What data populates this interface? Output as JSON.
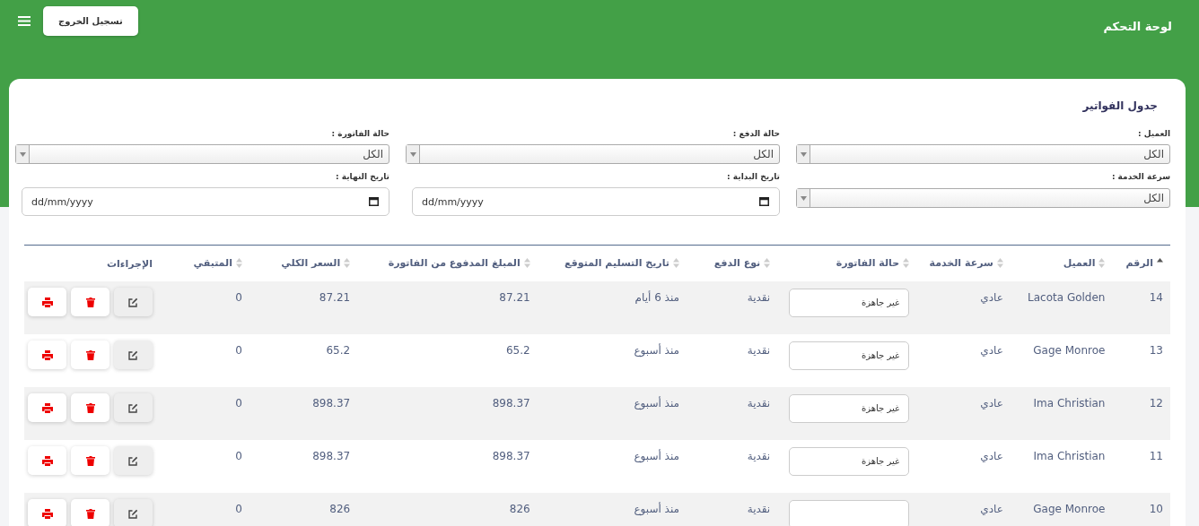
{
  "header": {
    "title": "لوحة التحكم",
    "logout": "تسجيل الخروج"
  },
  "card": {
    "title": "جدول الفواتير"
  },
  "filters": [
    {
      "kind": "select",
      "label": "العميل :",
      "value": "الكل"
    },
    {
      "kind": "select",
      "label": "حالة الدفع :",
      "value": "الكل"
    },
    {
      "kind": "select",
      "label": "حالة الفاتورة :",
      "value": "الكل"
    },
    {
      "kind": "select",
      "label": "سرعة الخدمة :",
      "value": "الكل"
    },
    {
      "kind": "date",
      "label": "تاريخ البداية :",
      "placeholder": "dd/mm/yyyy"
    },
    {
      "kind": "date",
      "label": "تاريخ النهاية :",
      "placeholder": "dd/mm/yyyy"
    }
  ],
  "table": {
    "columns": [
      {
        "label": "الرقم",
        "sortable": true,
        "sorted": true
      },
      {
        "label": "العميل",
        "sortable": true,
        "sorted": false
      },
      {
        "label": "سرعة الخدمة",
        "sortable": true,
        "sorted": false
      },
      {
        "label": "حالة الفاتورة",
        "sortable": true,
        "sorted": false
      },
      {
        "label": "نوع الدفع",
        "sortable": true,
        "sorted": false
      },
      {
        "label": "تاريخ التسليم المتوقع",
        "sortable": true,
        "sorted": false
      },
      {
        "label": "المبلغ المدفوع من الفاتورة",
        "sortable": true,
        "sorted": false
      },
      {
        "label": "السعر الكلي",
        "sortable": true,
        "sorted": false
      },
      {
        "label": "المتبقي",
        "sortable": true,
        "sorted": false
      },
      {
        "label": "الإجراءات",
        "sortable": false
      }
    ],
    "actions": [
      {
        "kind": "edit"
      },
      {
        "kind": "delete"
      },
      {
        "kind": "print"
      }
    ],
    "rows": [
      {
        "id": "14",
        "client": "Lacota Golden",
        "speed": "عادي",
        "status": "غير جاهزة",
        "payment": "نقدية",
        "delivery": "منذ 6 أيام",
        "paid": "87.21",
        "total": "87.21",
        "remaining": "0"
      },
      {
        "id": "13",
        "client": "Gage Monroe",
        "speed": "عادي",
        "status": "غير جاهزة",
        "payment": "نقدية",
        "delivery": "منذ أسبوع",
        "paid": "65.2",
        "total": "65.2",
        "remaining": "0"
      },
      {
        "id": "12",
        "client": "Ima Christian",
        "speed": "عادي",
        "status": "غير جاهزة",
        "payment": "نقدية",
        "delivery": "منذ أسبوع",
        "paid": "898.37",
        "total": "898.37",
        "remaining": "0"
      },
      {
        "id": "11",
        "client": "Ima Christian",
        "speed": "عادي",
        "status": "غير جاهزة",
        "payment": "نقدية",
        "delivery": "منذ أسبوع",
        "paid": "898.37",
        "total": "898.37",
        "remaining": "0"
      },
      {
        "id": "10",
        "client": "Gage Monroe",
        "speed": "عادي",
        "payment": "نقدية",
        "delivery": "منذ أسبوع",
        "paid": "826",
        "total": "826",
        "remaining": "0"
      }
    ]
  }
}
